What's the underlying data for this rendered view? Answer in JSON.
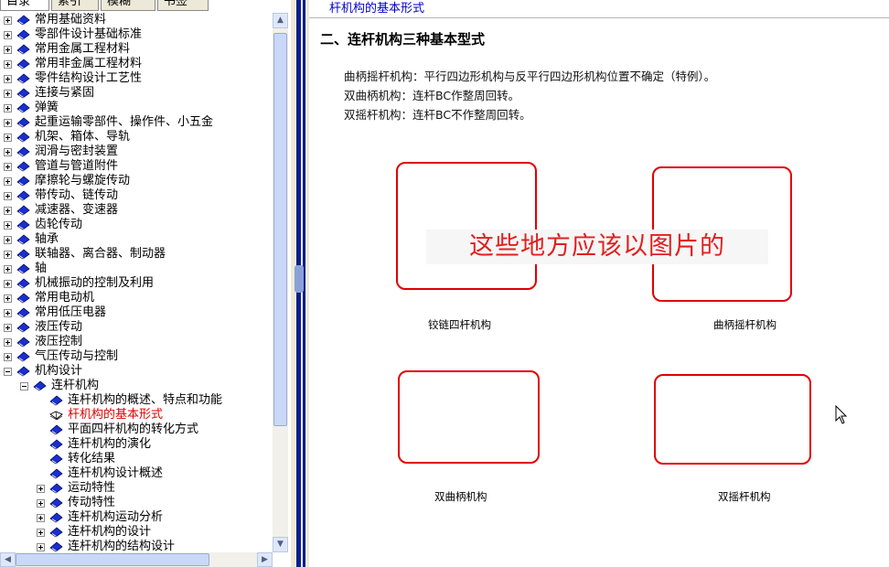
{
  "tabs": [
    "目录",
    "索引",
    "模糊",
    "书签"
  ],
  "tree": [
    {
      "label": "常用基础资料",
      "level": 0,
      "expander": "plus",
      "icon": "book-closed"
    },
    {
      "label": "零部件设计基础标准",
      "level": 0,
      "expander": "plus",
      "icon": "book-closed"
    },
    {
      "label": "常用金属工程材料",
      "level": 0,
      "expander": "plus",
      "icon": "book-closed"
    },
    {
      "label": "常用非金属工程材料",
      "level": 0,
      "expander": "plus",
      "icon": "book-closed"
    },
    {
      "label": "零件结构设计工艺性",
      "level": 0,
      "expander": "plus",
      "icon": "book-closed"
    },
    {
      "label": "连接与紧固",
      "level": 0,
      "expander": "plus",
      "icon": "book-closed"
    },
    {
      "label": "弹簧",
      "level": 0,
      "expander": "plus",
      "icon": "book-closed"
    },
    {
      "label": "起重运输零部件、操作件、小五金",
      "level": 0,
      "expander": "plus",
      "icon": "book-closed"
    },
    {
      "label": "机架、箱体、导轨",
      "level": 0,
      "expander": "plus",
      "icon": "book-closed"
    },
    {
      "label": "润滑与密封装置",
      "level": 0,
      "expander": "plus",
      "icon": "book-closed"
    },
    {
      "label": "管道与管道附件",
      "level": 0,
      "expander": "plus",
      "icon": "book-closed"
    },
    {
      "label": "摩擦轮与螺旋传动",
      "level": 0,
      "expander": "plus",
      "icon": "book-closed"
    },
    {
      "label": "带传动、链传动",
      "level": 0,
      "expander": "plus",
      "icon": "book-closed"
    },
    {
      "label": "减速器、变速器",
      "level": 0,
      "expander": "plus",
      "icon": "book-closed"
    },
    {
      "label": "齿轮传动",
      "level": 0,
      "expander": "plus",
      "icon": "book-closed"
    },
    {
      "label": "轴承",
      "level": 0,
      "expander": "plus",
      "icon": "book-closed"
    },
    {
      "label": "联轴器、离合器、制动器",
      "level": 0,
      "expander": "plus",
      "icon": "book-closed"
    },
    {
      "label": "轴",
      "level": 0,
      "expander": "plus",
      "icon": "book-closed"
    },
    {
      "label": "机械振动的控制及利用",
      "level": 0,
      "expander": "plus",
      "icon": "book-closed"
    },
    {
      "label": "常用电动机",
      "level": 0,
      "expander": "plus",
      "icon": "book-closed"
    },
    {
      "label": "常用低压电器",
      "level": 0,
      "expander": "plus",
      "icon": "book-closed"
    },
    {
      "label": "液压传动",
      "level": 0,
      "expander": "plus",
      "icon": "book-closed"
    },
    {
      "label": "液压控制",
      "level": 0,
      "expander": "plus",
      "icon": "book-closed"
    },
    {
      "label": "气压传动与控制",
      "level": 0,
      "expander": "plus",
      "icon": "book-closed"
    },
    {
      "label": "机构设计",
      "level": 0,
      "expander": "minus",
      "icon": "book-closed"
    },
    {
      "label": "连杆机构",
      "level": 1,
      "expander": "minus",
      "icon": "book-closed"
    },
    {
      "label": "连杆机构的概述、特点和功能",
      "level": 2,
      "expander": "none",
      "icon": "book-closed"
    },
    {
      "label": "杆机构的基本形式",
      "level": 2,
      "expander": "none",
      "icon": "book-open",
      "selected": true
    },
    {
      "label": "平面四杆机构的转化方式",
      "level": 2,
      "expander": "none",
      "icon": "book-closed"
    },
    {
      "label": "连杆机构的演化",
      "level": 2,
      "expander": "none",
      "icon": "book-closed"
    },
    {
      "label": "转化结果",
      "level": 2,
      "expander": "none",
      "icon": "book-closed"
    },
    {
      "label": "连杆机构设计概述",
      "level": 2,
      "expander": "none",
      "icon": "book-closed"
    },
    {
      "label": "运动特性",
      "level": 2,
      "expander": "plus",
      "icon": "book-closed"
    },
    {
      "label": "传动特性",
      "level": 2,
      "expander": "plus",
      "icon": "book-closed"
    },
    {
      "label": "连杆机构运动分析",
      "level": 2,
      "expander": "plus",
      "icon": "book-closed"
    },
    {
      "label": "连杆机构的设计",
      "level": 2,
      "expander": "plus",
      "icon": "book-closed"
    },
    {
      "label": "连杆机构的结构设计",
      "level": 2,
      "expander": "plus",
      "icon": "book-closed"
    }
  ],
  "content": {
    "breadcrumb": "杆机构的基本形式",
    "section_title": "二、连杆机构三种基本型式",
    "descriptions": [
      "曲柄摇杆机构：平行四边形机构与反平行四边形机构位置不确定（特例）。",
      "双曲柄机构：连杆BC作整周回转。",
      "双摇杆机构：连杆BC不作整周回转。"
    ],
    "figures": [
      {
        "caption": "铰链四杆机构"
      },
      {
        "caption": "曲柄摇杆机构"
      },
      {
        "caption": "双曲柄机构"
      },
      {
        "caption": "双摇杆机构"
      }
    ],
    "overlay_text": "这些地方应该以图片的"
  },
  "colors": {
    "selected_text": "#e00000",
    "frame_border": "#e00000",
    "overlay_text": "#e02020",
    "splitter": "#0a1f8c",
    "book_icon": "#1a2fd0",
    "link_text": "#0000d0"
  }
}
